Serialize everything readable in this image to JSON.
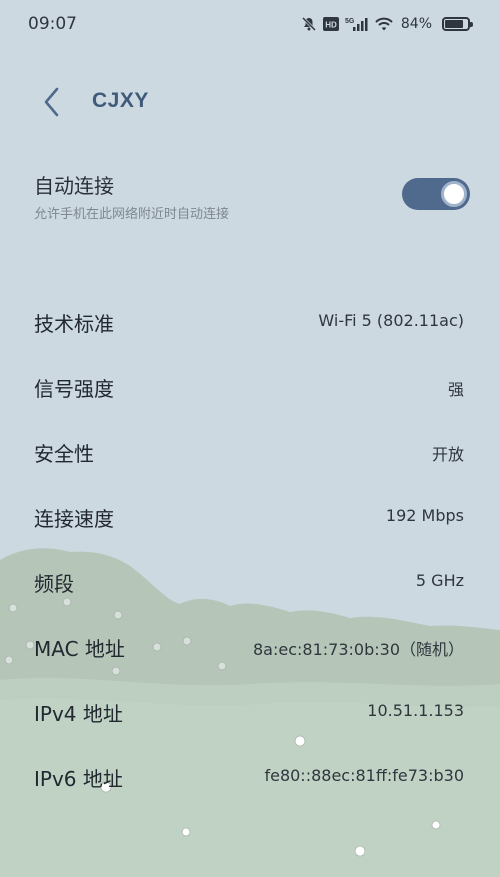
{
  "status_bar": {
    "time": "09:07",
    "icons": [
      "bell-muted-icon",
      "hd-icon",
      "5g-signal-icon",
      "wifi-icon",
      "battery-icon"
    ],
    "hd_label": "HD",
    "network_label": "5G",
    "battery_percent": "84%",
    "battery_level": 0.84
  },
  "header": {
    "back_icon": "chevron-left-icon",
    "title": "CJXY"
  },
  "auto_connect": {
    "title": "自动连接",
    "subtitle": "允许手机在此网络附近时自动连接",
    "enabled": true
  },
  "details": [
    {
      "label": "技术标准",
      "value": "Wi-Fi 5 (802.11ac)"
    },
    {
      "label": "信号强度",
      "value": "强"
    },
    {
      "label": "安全性",
      "value": "开放"
    },
    {
      "label": "连接速度",
      "value": "192 Mbps"
    },
    {
      "label": "频段",
      "value": "5 GHz"
    },
    {
      "label": "MAC 地址",
      "value": "8a:ec:81:73:0b:30（随机）"
    },
    {
      "label": "IPv4 地址",
      "value": "10.51.1.153"
    },
    {
      "label": "IPv6 地址",
      "value": "fe80::88ec:81ff:fe73:b30"
    }
  ],
  "colors": {
    "sky": "#cdd9e1",
    "hill": "#b5c6b8",
    "meadow": "#bdcfc1",
    "accent": "#4f6a8d",
    "title": "#3f5a7a"
  }
}
